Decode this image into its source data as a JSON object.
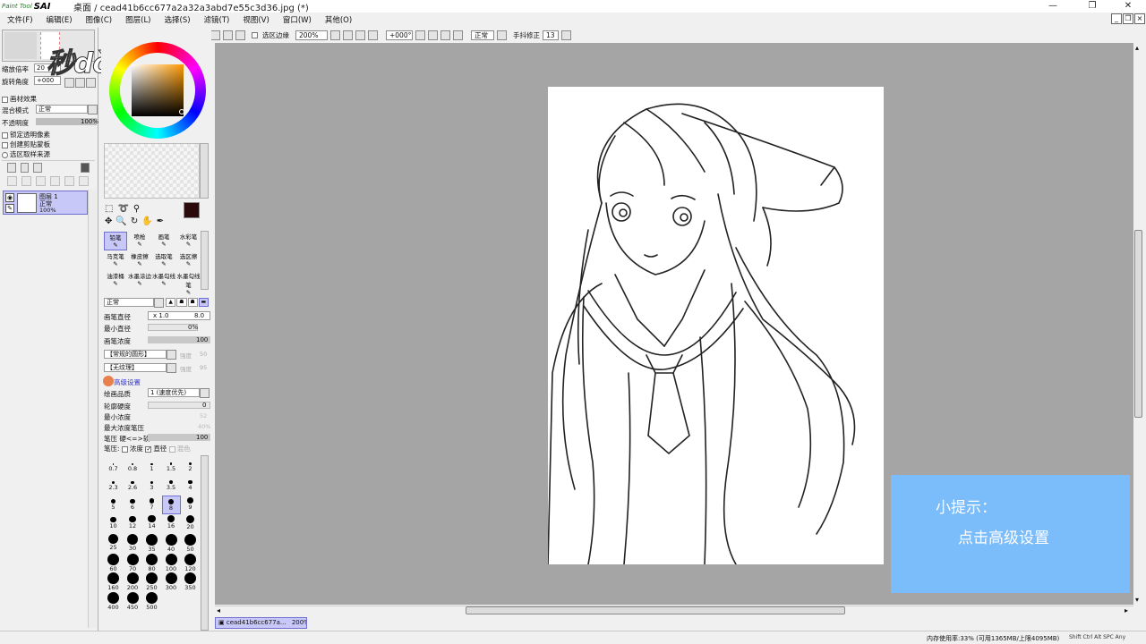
{
  "app": {
    "logo_small": "Paint Tool",
    "logo_big": "SAI",
    "title": "桌面 / cead41b6cc677a2a32a3abd7e55c3d36.jpg (*)"
  },
  "menu": [
    "文件(F)",
    "编辑(E)",
    "图像(C)",
    "图层(L)",
    "选择(S)",
    "滤镜(T)",
    "视图(V)",
    "窗口(W)",
    "其他(O)"
  ],
  "toolbar": {
    "selection_edge_label": "选区边缘",
    "zoom": "200%",
    "angle": "+000°",
    "mode": "正常",
    "stabilizer_label": "手抖修正",
    "stabilizer_value": "13"
  },
  "navigator": {
    "zoom_label": "缩放倍率",
    "zoom_value": "20",
    "rotate_label": "旋转角度",
    "rotate_value": "+000"
  },
  "watermark": "秒dòng视频",
  "layer_panel": {
    "paper_effect": "画材效果",
    "blend_label": "混合模式",
    "blend_value": "正常",
    "opacity_label": "不透明度",
    "opacity_value": "100%",
    "checks": [
      "锁定透明像素",
      "创建剪贴蒙板",
      "选区取样来源"
    ],
    "layer_name": "图层 1",
    "layer_mode": "正常",
    "layer_opacity": "100%"
  },
  "tools": {
    "brushes": [
      "铅笔",
      "喷枪",
      "画笔",
      "水彩笔",
      "马克笔",
      "橡皮擦",
      "选取笔",
      "选区擦",
      "油漆桶",
      "水墨涂边",
      "水墨勾线",
      "水墨勾线笔"
    ],
    "mode": "正常",
    "size_label": "画笔直径",
    "size_mult": "x 1.0",
    "size_value": "8.0",
    "min_size_label": "最小直径",
    "min_size_value": "0%",
    "density_label": "画笔浓度",
    "density_value": "100",
    "shape_label": "【常规的圆形】",
    "shape_strength": "强度",
    "shape_strength_value": "50",
    "texture_label": "【无纹理】",
    "texture_strength": "强度",
    "texture_strength_value": "95",
    "advanced": "高级设置",
    "quality_label": "绘画品质",
    "quality_value": "1 (速度优先)",
    "hardness_label": "轮廓硬度",
    "hardness_value": "0",
    "min_density_label": "最小浓度",
    "min_density_value": "52",
    "max_pressure_label": "最大浓度笔压",
    "max_pressure_value": "40%",
    "pressure_hardness_label": "笔压  硬<=>软",
    "pressure_hardness_value": "100",
    "pressure_label": "笔压:",
    "pressure_density": "浓度",
    "pressure_size": "直径",
    "pressure_blend": "混色"
  },
  "brush_sizes": [
    "0.7",
    "0.8",
    "1",
    "1.5",
    "2",
    "2.3",
    "2.6",
    "3",
    "3.5",
    "4",
    "5",
    "6",
    "7",
    "8",
    "9",
    "10",
    "12",
    "14",
    "16",
    "20",
    "25",
    "30",
    "35",
    "40",
    "50",
    "60",
    "70",
    "80",
    "100",
    "120",
    "160",
    "200",
    "250",
    "300",
    "350",
    "400",
    "450",
    "500"
  ],
  "tip": {
    "line1": "小提示：",
    "line2": "点击高级设置"
  },
  "doc_tab": {
    "name": "cead41b6cc677a...",
    "zoom": "200%"
  },
  "status": {
    "memory": "内存使用率:33% (可用1365MB/上限4095MB)",
    "keys": "Shift Ctrl Alt SPC  Any"
  },
  "colors": {
    "tip_bg": "#7bbcfa",
    "canvas_bg": "#a5a5a5",
    "selected": "#c8c8f8",
    "primary_color": "#2a0a0a"
  }
}
